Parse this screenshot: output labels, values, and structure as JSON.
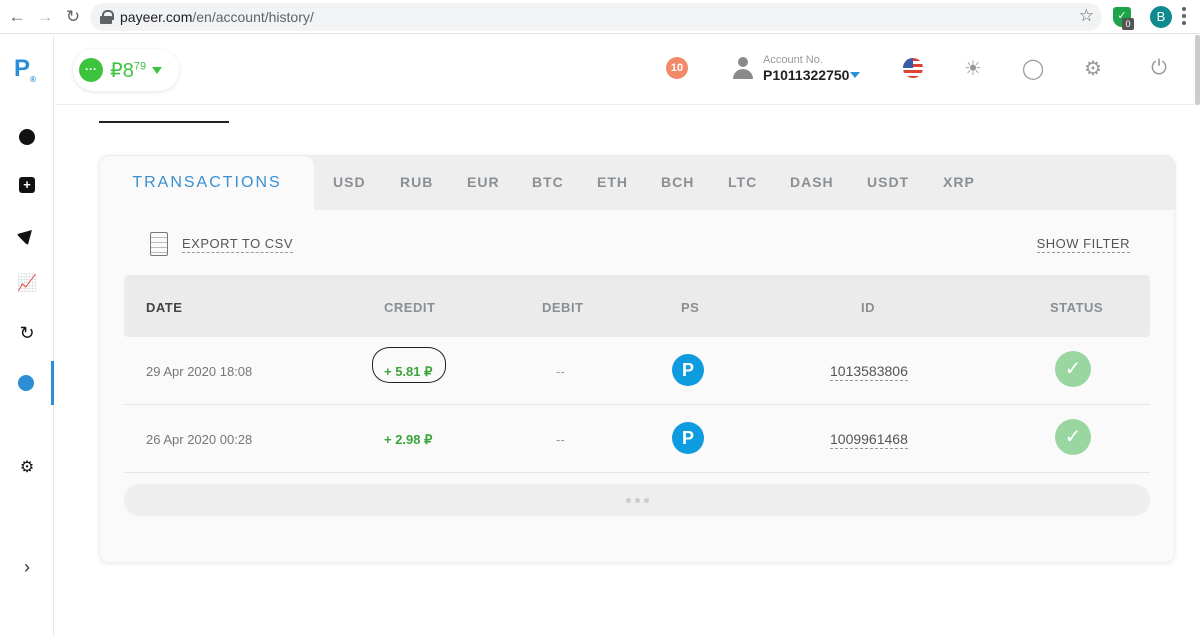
{
  "browser": {
    "url_domain": "payeer.com",
    "url_path": "/en/account/history/",
    "extension_badge": "0",
    "profile_initial": "B"
  },
  "sidebar": {
    "logo": "P",
    "logo_mark": "®",
    "items": [
      {
        "name": "dashboard"
      },
      {
        "name": "add-funds"
      },
      {
        "name": "send"
      },
      {
        "name": "exchange-chart"
      },
      {
        "name": "swap"
      },
      {
        "name": "history"
      },
      {
        "name": "settings"
      }
    ]
  },
  "header": {
    "balance_symbol": "₽",
    "balance_main": "8",
    "balance_decimals": "79",
    "notifications": "10",
    "account_label": "Account No.",
    "account_number": "P1011322750"
  },
  "tabs": {
    "active": "TRANSACTIONS",
    "items": [
      "USD",
      "RUB",
      "EUR",
      "BTC",
      "ETH",
      "BCH",
      "LTC",
      "DASH",
      "USDT",
      "XRP"
    ]
  },
  "toolbar": {
    "export_label": "EXPORT TO CSV",
    "filter_label": "SHOW FILTER"
  },
  "table": {
    "columns": [
      "DATE",
      "CREDIT",
      "DEBIT",
      "PS",
      "ID",
      "STATUS"
    ],
    "rows": [
      {
        "date": "29 Apr 2020 18:08",
        "credit": "+ 5.81 ₽",
        "debit": "--",
        "ps": "P",
        "id": "1013583806",
        "status": "✓"
      },
      {
        "date": "26 Apr 2020 00:28",
        "credit": "+ 2.98 ₽",
        "debit": "--",
        "ps": "P",
        "id": "1009961468",
        "status": "✓"
      }
    ]
  }
}
